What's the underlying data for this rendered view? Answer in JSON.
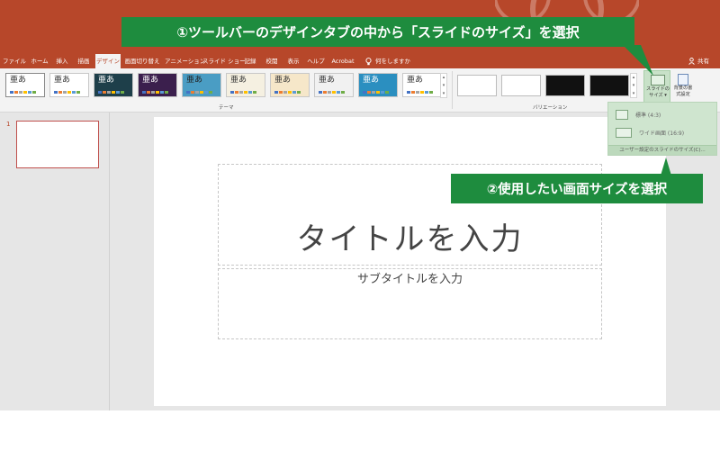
{
  "tabs": [
    {
      "label": "ファイル",
      "active": false
    },
    {
      "label": "ホーム",
      "active": false
    },
    {
      "label": "挿入",
      "active": false
    },
    {
      "label": "描画",
      "active": false
    },
    {
      "label": "デザイン",
      "active": true
    },
    {
      "label": "画面切り替え",
      "active": false
    },
    {
      "label": "アニメーション",
      "active": false
    },
    {
      "label": "スライド ショー",
      "active": false
    },
    {
      "label": "記録",
      "active": false
    },
    {
      "label": "校閲",
      "active": false
    },
    {
      "label": "表示",
      "active": false
    },
    {
      "label": "ヘルプ",
      "active": false
    },
    {
      "label": "Acrobat",
      "active": false
    }
  ],
  "help_search": {
    "icon": "lightbulb-icon",
    "label": "何をしますか"
  },
  "share": {
    "icon": "person-icon",
    "label": "共有"
  },
  "ribbon": {
    "themes_group_label": "テーマ",
    "variants_group_label": "バリエーション",
    "theme_sample_text": "亜あ",
    "themes": [
      {
        "bg": "#ffffff",
        "fg": "#333333"
      },
      {
        "bg": "#ffffff",
        "fg": "#333333"
      },
      {
        "bg": "#1e3f4a",
        "fg": "#ffffff"
      },
      {
        "bg": "#3b1f4d",
        "fg": "#ffffff"
      },
      {
        "bg": "#4a9dc4",
        "fg": "#222222"
      },
      {
        "bg": "#f5f0e1",
        "fg": "#333333"
      },
      {
        "bg": "#f6e7c9",
        "fg": "#333333"
      },
      {
        "bg": "#f1f1f1",
        "fg": "#333333"
      },
      {
        "bg": "#2b8fc0",
        "fg": "#ffffff"
      },
      {
        "bg": "#ffffff",
        "fg": "#333333"
      }
    ],
    "variants": [
      {
        "bg": "#ffffff"
      },
      {
        "bg": "#ffffff"
      },
      {
        "bg": "#111111"
      },
      {
        "bg": "#111111"
      }
    ],
    "slide_size_button": {
      "icon": "slide-size-icon",
      "line1": "スライドの",
      "line2": "サイズ ▾"
    },
    "format_background_button": {
      "icon": "format-background-icon",
      "line1": "背景の書",
      "line2": "式設定"
    }
  },
  "slide_size_menu": {
    "items": [
      {
        "label": "標準 (4:3)",
        "icon": "standard-4-3-icon"
      },
      {
        "label": "ワイド画面 (16:9)",
        "icon": "widescreen-16-9-icon"
      }
    ],
    "footer": "ユーザー設定のスライドのサイズ(C)..."
  },
  "thumbnail": {
    "number": "1"
  },
  "slide": {
    "title_placeholder": "タイトルを入力",
    "subtitle_placeholder": "サブタイトルを入力"
  },
  "callouts": {
    "step1": "①ツールバーのデザインタブの中から「スライドのサイズ」を選択",
    "step2": "②使用したい画面サイズを選択"
  },
  "colors": {
    "accent": "#b7472a",
    "callout_green": "#1e8c3e",
    "menu_green": "#cfe5cf"
  }
}
